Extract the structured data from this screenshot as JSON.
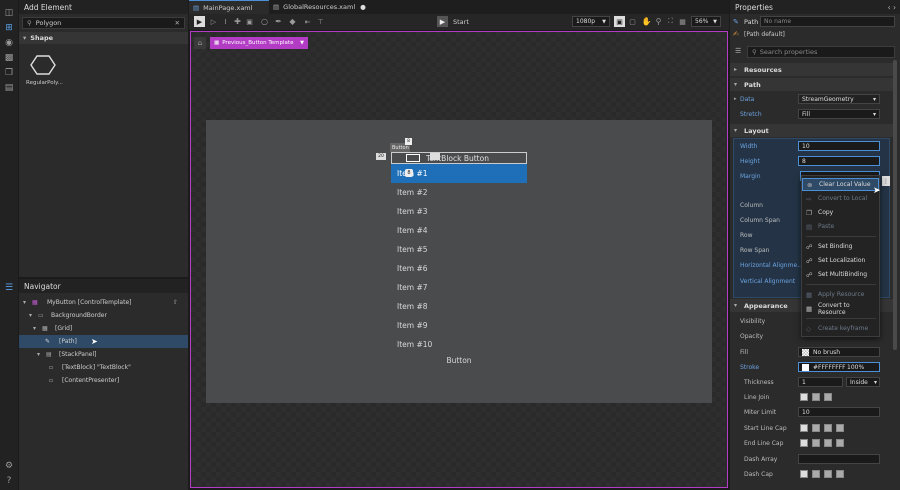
{
  "left_panel": {
    "title": "Add Element",
    "search_value": "Polygon",
    "section": "Shape",
    "element_label": "RegularPoly..."
  },
  "navigator": {
    "title": "Navigator",
    "items": [
      {
        "label": "MyButton [ControlTemplate]"
      },
      {
        "label": "BackgroundBorder"
      },
      {
        "label": "[Grid]"
      },
      {
        "label": "[Path]"
      },
      {
        "label": "[StackPanel]"
      },
      {
        "label": "[TextBlock] \"TextBlock\""
      },
      {
        "label": "[ContentPresenter]"
      }
    ]
  },
  "tabs": [
    {
      "label": "MainPage.xaml"
    },
    {
      "label": "GlobalResources.xaml"
    }
  ],
  "toolbar": {
    "start": "Start",
    "resolution": "1080p",
    "zoom": "56%"
  },
  "breadcrumb": {
    "label": "Previous_Button Template"
  },
  "canvas": {
    "button_tag": "Button",
    "selection_w": "20",
    "selection_h": "8",
    "header_text": "TextBlock   Button",
    "items": [
      "Item #1",
      "Item #2",
      "Item #3",
      "Item #4",
      "Item #5",
      "Item #6",
      "Item #7",
      "Item #8",
      "Item #9",
      "Item #10"
    ],
    "bottom_button": "Button"
  },
  "properties": {
    "title": "Properties",
    "element_type": "Path",
    "name_placeholder": "No name",
    "style": "[Path default]",
    "search_placeholder": "Search properties",
    "sections": {
      "resources": "Resources",
      "path": "Path",
      "layout": "Layout",
      "appearance": "Appearance"
    },
    "data_label": "Data",
    "data_value": "StreamGeometry",
    "stretch_label": "Stretch",
    "stretch_value": "Fill",
    "width_label": "Width",
    "width_value": "10",
    "height_label": "Height",
    "height_value": "8",
    "margin_label": "Margin",
    "column_label": "Column",
    "column_span_label": "Column Span",
    "row_label": "Row",
    "row_span_label": "Row Span",
    "halign_label": "Horizontal Alignme...",
    "valign_label": "Vertical Alignment",
    "visibility_label": "Visibility",
    "opacity_label": "Opacity",
    "fill_label": "Fill",
    "fill_value": "No brush",
    "stroke_label": "Stroke",
    "stroke_value": "#FFFFFFFF",
    "stroke_opacity": "100%",
    "thickness_label": "Thickness",
    "thickness_value": "1",
    "thickness_mode": "Inside",
    "line_join_label": "Line Join",
    "miter_label": "Miter Limit",
    "miter_value": "10",
    "start_cap_label": "Start Line Cap",
    "end_cap_label": "End Line Cap",
    "dash_array_label": "Dash Array",
    "dash_cap_label": "Dash Cap"
  },
  "context_menu": {
    "items": [
      {
        "label": "Clear Local Value"
      },
      {
        "label": "Convert to Local"
      },
      {
        "label": "Copy"
      },
      {
        "label": "Paste"
      },
      {
        "label": "Set Binding"
      },
      {
        "label": "Set Localization"
      },
      {
        "label": "Set MultiBinding"
      },
      {
        "label": "Apply Resource"
      },
      {
        "label": "Convert to Resource"
      },
      {
        "label": "Create keyframe"
      }
    ]
  },
  "colors": {
    "accent": "#1e6fb8",
    "selection_magenta": "#b23cc4",
    "panel": "#2b2b2b"
  }
}
